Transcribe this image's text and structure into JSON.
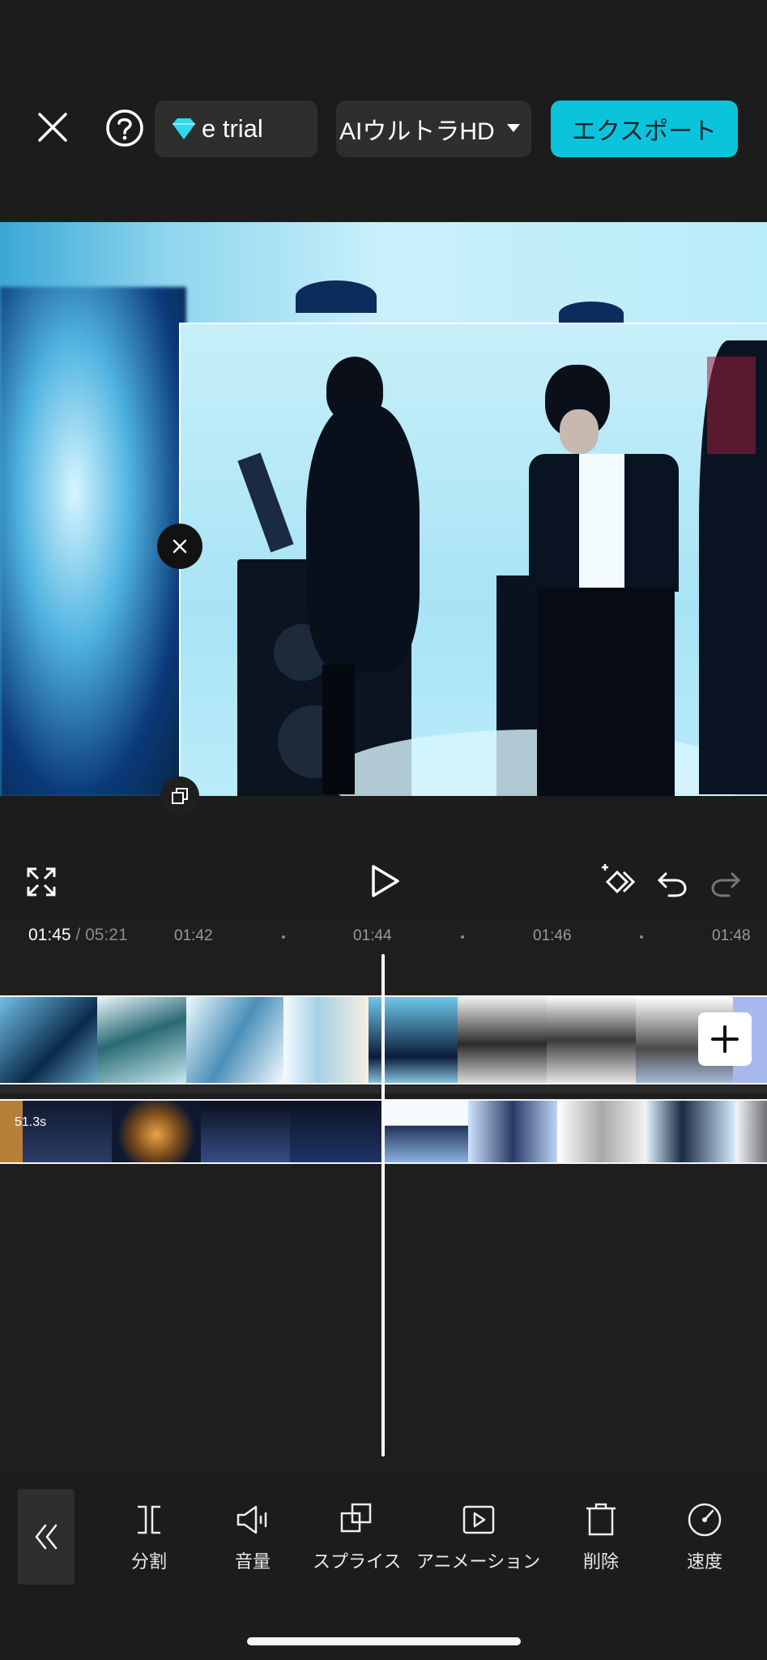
{
  "header": {
    "trial_label": "e trial",
    "resolution_label": "AIウルトラHD",
    "export_label": "エクスポート",
    "accent_color": "#0cc3dc"
  },
  "icons": {
    "close": "close-icon",
    "help": "help-icon",
    "gem": "gem-icon",
    "fullscreen": "fullscreen-icon",
    "play": "play-icon",
    "keyframe": "keyframe-add-icon",
    "undo": "undo-icon",
    "redo": "redo-icon"
  },
  "timeline": {
    "current_time": "01:45",
    "separator": "/",
    "total_time": "05:21",
    "ticks": [
      "01:42",
      "01:44",
      "01:46",
      "01:48"
    ],
    "overlay_duration": "51.3s"
  },
  "toolbar": {
    "tools": [
      {
        "label": "分割",
        "icon": "split-icon"
      },
      {
        "label": "音量",
        "icon": "volume-icon"
      },
      {
        "label": "スプライス",
        "icon": "splice-icon"
      },
      {
        "label": "アニメーション",
        "icon": "animation-icon"
      },
      {
        "label": "削除",
        "icon": "delete-icon"
      },
      {
        "label": "速度",
        "icon": "speed-icon"
      }
    ]
  }
}
